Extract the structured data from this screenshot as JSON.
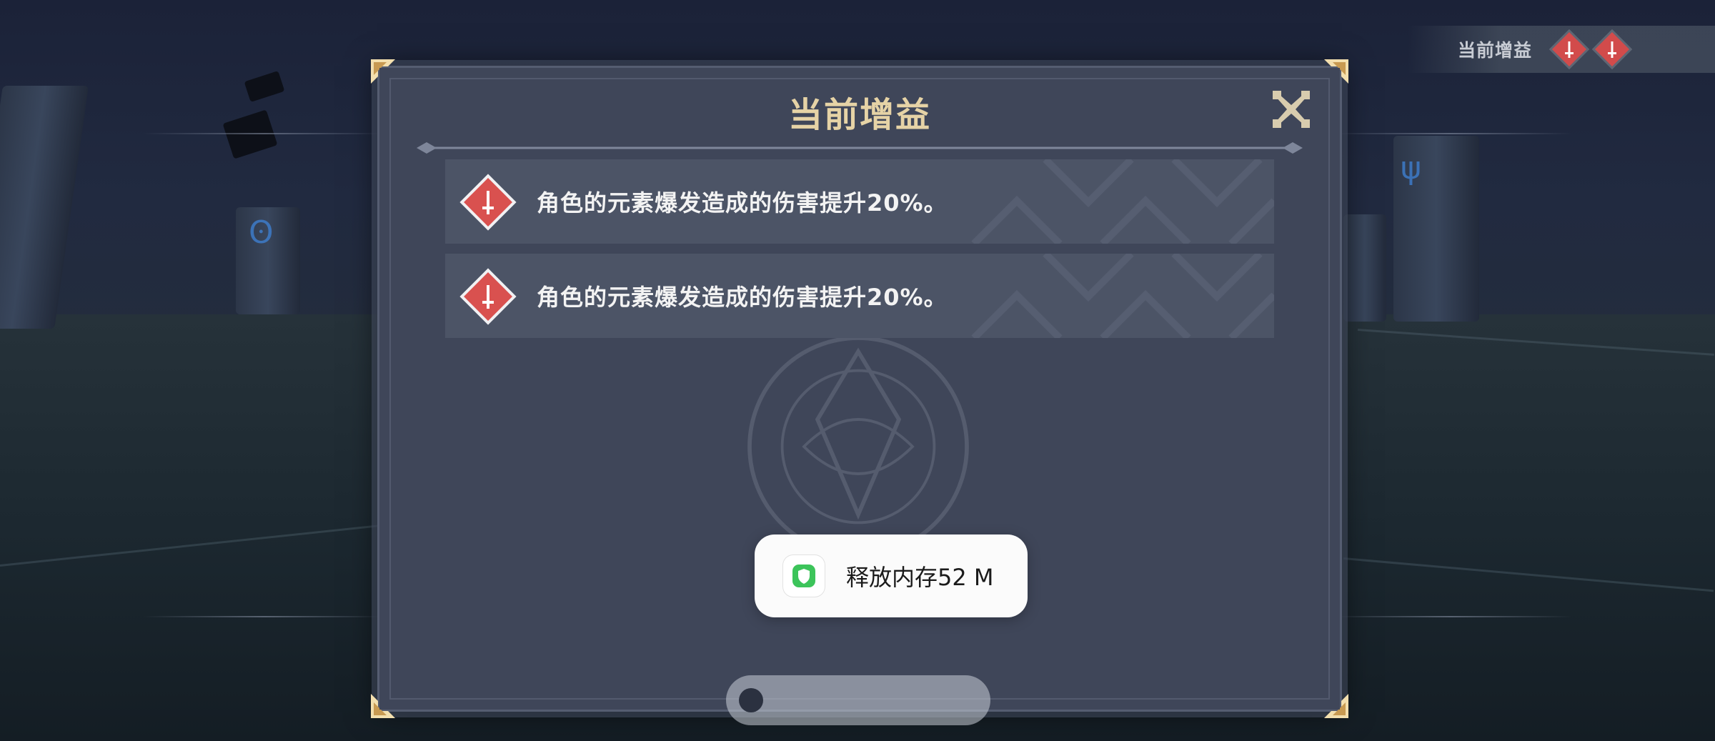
{
  "hud": {
    "buff_bar_title": "当前增益"
  },
  "panel": {
    "title": "当前增益",
    "buffs": [
      {
        "icon": "sword-icon",
        "text": "角色的元素爆发造成的伤害提升20%。"
      },
      {
        "icon": "sword-icon",
        "text": "角色的元素爆发造成的伤害提升20%。"
      }
    ]
  },
  "toast": {
    "icon": "shield-icon",
    "text": "释放内存52 M"
  },
  "colors": {
    "panel_bg": "#3f4659",
    "title_gold": "#e6d3a6",
    "buff_red": "#d9514f",
    "toast_green": "#3cc45a"
  }
}
